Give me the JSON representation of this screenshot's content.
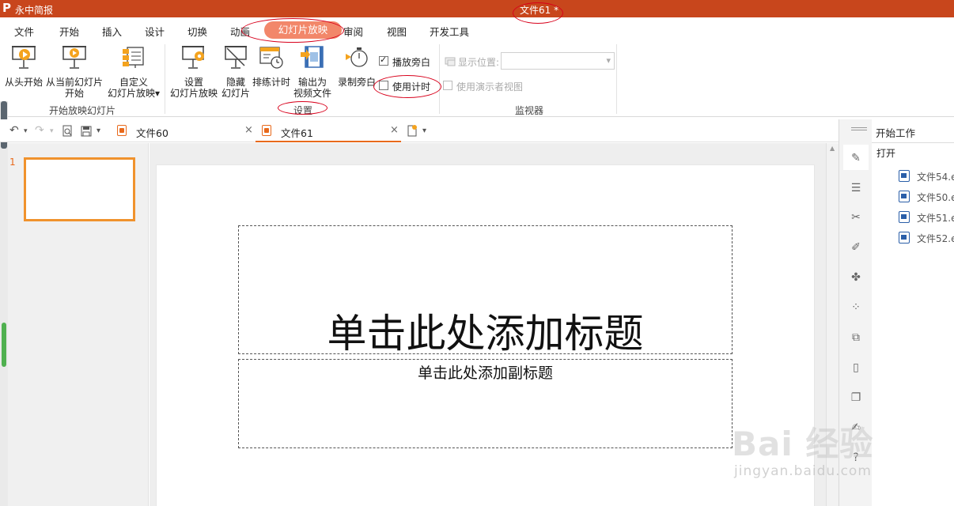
{
  "app": {
    "logo": "P",
    "name": "永中简报",
    "doc_title": "文件61 *"
  },
  "menu": {
    "tabs": [
      "文件",
      "开始",
      "插入",
      "设计",
      "切换",
      "动画",
      "幻灯片放映",
      "审阅",
      "视图",
      "开发工具"
    ],
    "active": "幻灯片放映"
  },
  "ribbon": {
    "start_group": {
      "label": "开始放映幻灯片",
      "from_start": "从头开始",
      "from_current_1": "从当前幻灯片",
      "from_current_2": "开始",
      "custom_1": "自定义",
      "custom_2": "幻灯片放映▾"
    },
    "setup_group": {
      "label": "设置",
      "setup_1": "设置",
      "setup_2": "幻灯片放映",
      "hide_1": "隐藏",
      "hide_2": "幻灯片",
      "rehearse": "排练计时",
      "export_1": "输出为",
      "export_2": "视频文件",
      "record": "录制旁白",
      "play_narration": "播放旁白",
      "play_narration_checked": true,
      "use_timing": "使用计时",
      "use_timing_checked": false
    },
    "monitor_group": {
      "label": "监视器",
      "display_position": "显示位置:",
      "presenter_view": "使用演示者视图"
    }
  },
  "tabs": {
    "doc1": "文件60",
    "doc2": "文件61",
    "close": "×"
  },
  "slides": {
    "number": "1",
    "title_placeholder": "单击此处添加标题",
    "subtitle_placeholder": "单击此处添加副标题"
  },
  "taskpane": {
    "title": "开始工作",
    "open": "打开",
    "recent": [
      "文件54.e",
      "文件50.e",
      "文件51.e",
      "文件52.e"
    ]
  },
  "watermark": {
    "brand": "Bai 经验",
    "url": "jingyan.baidu.com"
  },
  "colors": {
    "titlebar": "#c8461c",
    "active_tab": "#f2876a",
    "accent": "#e8691b",
    "annotation": "#d8001b"
  }
}
